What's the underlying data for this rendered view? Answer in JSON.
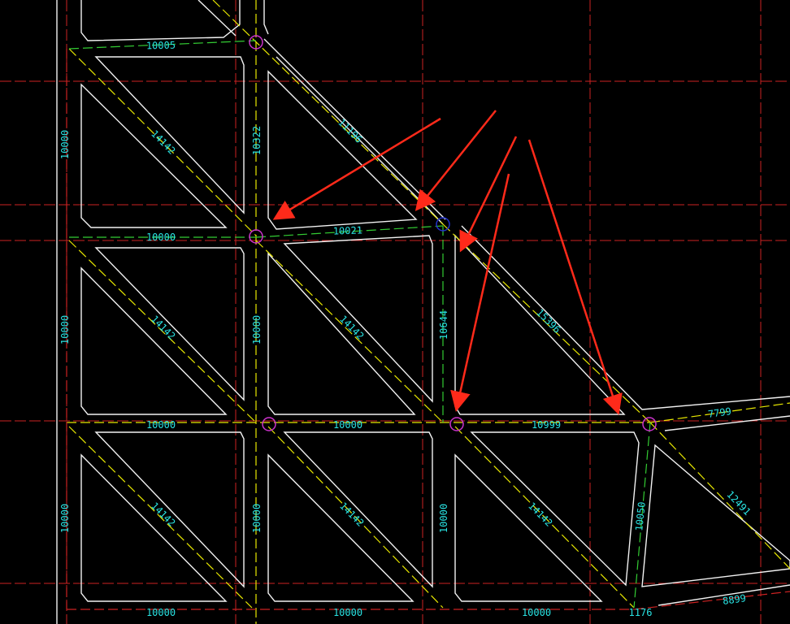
{
  "colors": {
    "background": "#000000",
    "grid_red": "#cc2222",
    "beam_edge": "#f2f2f2",
    "axis_yellow": "#e8e800",
    "axis_green": "#33cc33",
    "dim_text": "#29e3e3",
    "node_magenta": "#cc33cc",
    "node_blue": "#2233cc",
    "arrow_red": "#ff2a1a"
  },
  "icons": [
    "magenta-node-marker",
    "blue-node-marker",
    "red-annotation-arrow"
  ],
  "dimensions": {
    "top_beam": "10005",
    "upper_left_vertical": "10000",
    "upper_diagonal": "14142",
    "center_vertical_top": "10322",
    "long_diagonal_top": "11196",
    "mid_horizontal_left": "10000",
    "mid_horizontal_short": "10021",
    "middle_left_vertical": "10000",
    "middle_left_diagonal": "14142",
    "middle_center_vertical": "10000",
    "middle_center_diagonal": "14142",
    "middle_right_vertical": "10644",
    "long_diagonal_lower": "15396",
    "lower_horizontal_1": "10000",
    "lower_horizontal_2": "10000",
    "lower_horizontal_3": "10999",
    "right_beam_top": "7799",
    "bottom_left_vertical": "10000",
    "bottom_left_diagonal": "14142",
    "bottom_center_vertical": "10000",
    "bottom_center_diagonal": "14142",
    "bottom_right_vertical": "10000",
    "bottom_right_diagonal": "14142",
    "right_slanted_vertical": "10050",
    "right_lower_diagonal": "12491",
    "bottom_beam_1": "10000",
    "bottom_beam_2": "10000",
    "bottom_beam_3": "10000",
    "bottom_small": "1176",
    "bottom_right_beam": "8899"
  }
}
